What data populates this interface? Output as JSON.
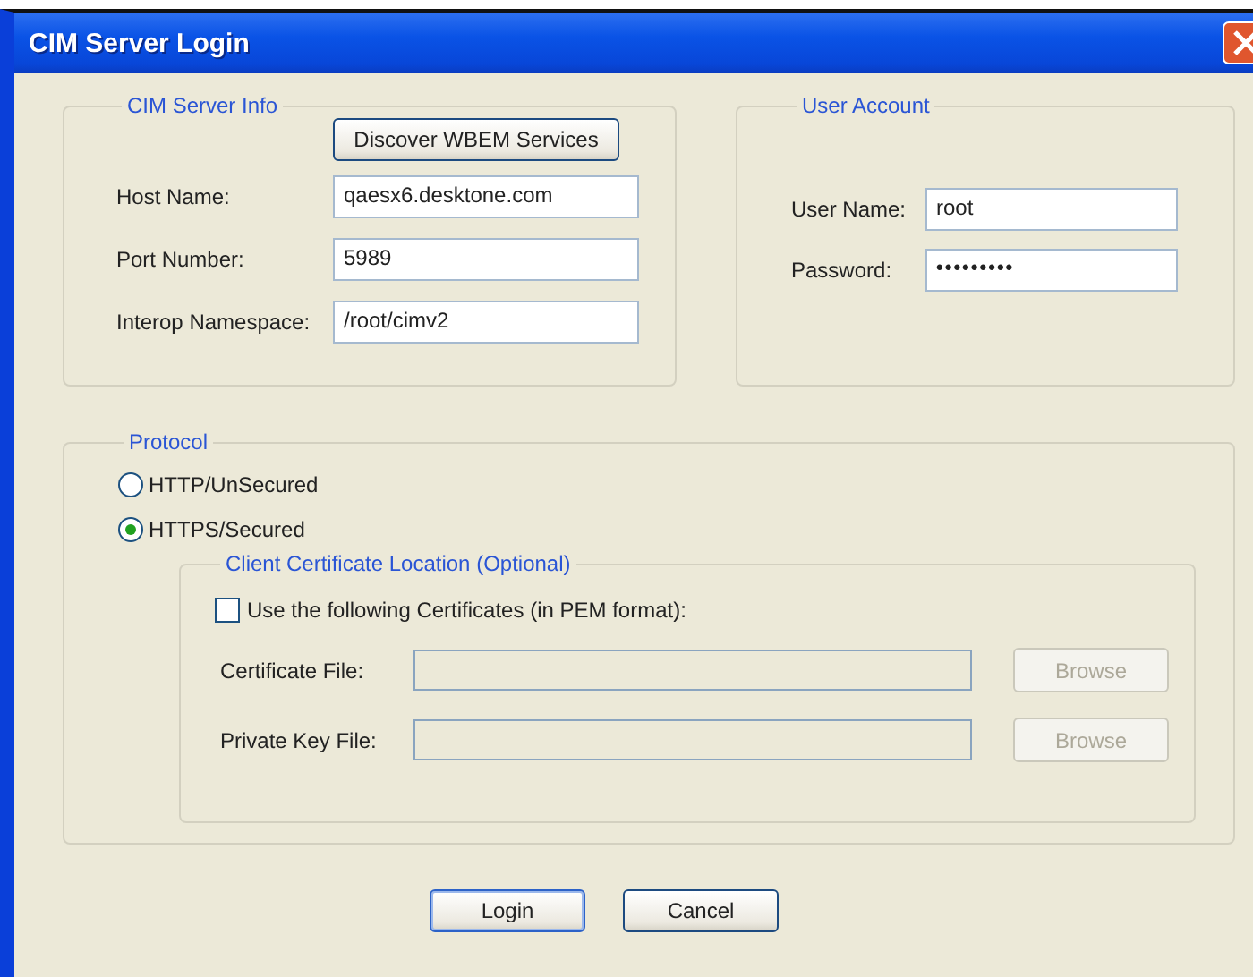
{
  "window": {
    "title": "CIM Server Login"
  },
  "server_info": {
    "title": "CIM Server Info",
    "discover_button": "Discover WBEM Services",
    "fields": [
      {
        "label": "Host Name:",
        "value": "qaesx6.desktone.com"
      },
      {
        "label": "Port Number:",
        "value": "5989"
      },
      {
        "label": "Interop Namespace:",
        "value": "/root/cimv2"
      }
    ]
  },
  "user_account": {
    "title": "User Account",
    "fields": [
      {
        "label": "User Name:",
        "value": "root",
        "kind": "text"
      },
      {
        "label": "Password:",
        "value": "•••••••••",
        "kind": "password"
      }
    ]
  },
  "protocol": {
    "title": "Protocol",
    "options": [
      {
        "label": "HTTP/UnSecured",
        "selected": false
      },
      {
        "label": "HTTPS/Secured",
        "selected": true
      }
    ],
    "client_certificate": {
      "title": "Client Certificate Location (Optional)",
      "use_certificates": {
        "label": "Use the following Certificates (in PEM format):",
        "checked": false
      },
      "files": [
        {
          "label": "Certificate File:",
          "button": "Browse",
          "disabled": true
        },
        {
          "label": "Private Key File:",
          "button": "Browse",
          "disabled": true
        }
      ]
    }
  },
  "buttons": [
    {
      "label": "Login",
      "default": true
    },
    {
      "label": "Cancel",
      "default": false
    }
  ]
}
